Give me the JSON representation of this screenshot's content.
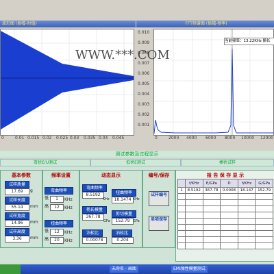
{
  "left_panel": {
    "title": "波形图 (振幅-时值)"
  },
  "right_panel": {
    "title": "FFT频谱图 (振幅-频率)",
    "cursor_label": "当前频率：13.22KHz  振长"
  },
  "left_x_ticks": [
    "0",
    "0.01",
    "0.015",
    "0.02",
    "0.025",
    "0.03",
    "0.035",
    "0.04",
    "0.045"
  ],
  "right_x_ticks": [
    "0",
    "2000",
    "4000",
    "6000",
    "8000",
    "10000",
    "12000"
  ],
  "right_y_ticks": [
    "0.010",
    "0.009",
    "0.008",
    "0.007",
    "0.006",
    "0.005",
    "0.004",
    "0.003",
    "0.002",
    "0.001"
  ],
  "watermark": "WWW.***.COM",
  "center_banner": "测试参数及过程显示",
  "tabs": [
    "弯状E/U测试",
    "低状E测试",
    "棒状试样"
  ],
  "basic": {
    "title": "基本参数",
    "rows": [
      {
        "label": "试样质量",
        "value": "17.69",
        "unit": "g"
      },
      {
        "label": "试样长度",
        "value": "55.14",
        "unit": "mm"
      },
      {
        "label": "试样宽度",
        "value": "14.96",
        "unit": "mm"
      },
      {
        "label": "试样高度",
        "value": "3.36",
        "unit": "mm"
      }
    ]
  },
  "freq": {
    "title": "频率设置",
    "label1": "弯曲频率",
    "low_prefix": "低",
    "low_value": "1",
    "high_prefix": "高",
    "high_value": "12",
    "unit": "KHz",
    "label2": "扭曲频率",
    "low2_value": "12",
    "high2_value": "20"
  },
  "dynamic": {
    "title": "动态显示",
    "items": [
      {
        "label": "弯曲频率",
        "value": "8.5192",
        "unit": "KHz"
      },
      {
        "label": "扭曲频率",
        "value": "18.1474",
        "unit": "KHz"
      },
      {
        "label": "杨氏模量",
        "value": "367.78",
        "unit": "GPa"
      },
      {
        "label": "剪切模量",
        "value": "152.79",
        "unit": "GPa"
      },
      {
        "label": "泊松比",
        "value": "0.00078",
        "unit": ""
      },
      {
        "label": "泊松比",
        "value": "0.204",
        "unit": ""
      }
    ]
  },
  "edit": {
    "title": "编号/保存",
    "btn1": "试样编号",
    "btn2": "单项保存"
  },
  "report": {
    "title": "报 告 保 存 显 示",
    "headers": [
      "",
      "f/KHz",
      "E/GPa",
      "D",
      "f/KHz",
      "G/GPa"
    ],
    "rows": [
      [
        "1",
        "8.5192",
        "367.78",
        "0.0008",
        "18.147",
        "152.79"
      ]
    ],
    "empty_rows": 9
  },
  "taskbar": {
    "items": [
      "未命名 - 画图",
      "EMI弹性模量测试"
    ]
  }
}
